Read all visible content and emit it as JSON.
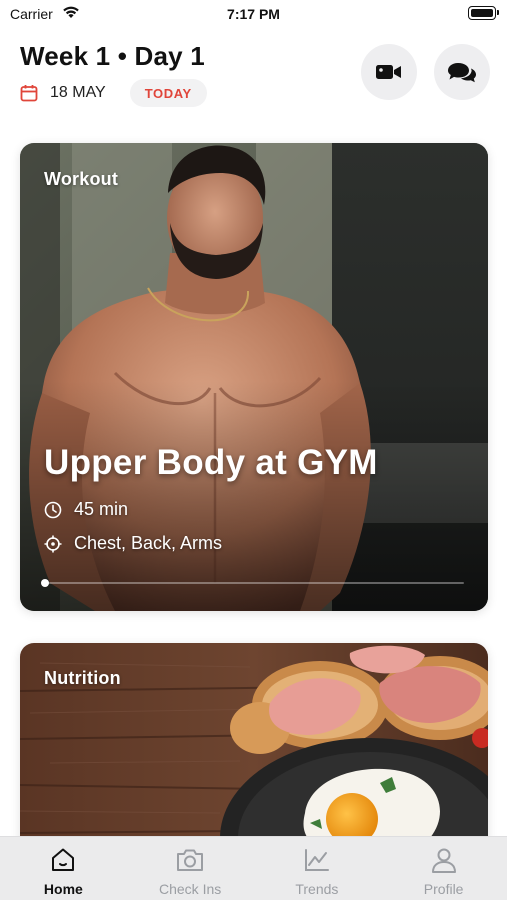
{
  "status_bar": {
    "carrier": "Carrier",
    "time": "7:17 PM"
  },
  "header": {
    "title": "Week 1 • Day 1",
    "date": "18 MAY",
    "today_badge": "TODAY"
  },
  "workout_card": {
    "label": "Workout",
    "title": "Upper Body at GYM",
    "duration": "45 min",
    "focus": "Chest, Back, Arms",
    "progress": 0
  },
  "nutrition_card": {
    "label": "Nutrition"
  },
  "tab_bar": {
    "items": [
      {
        "label": "Home",
        "icon": "home-icon",
        "active": true
      },
      {
        "label": "Check Ins",
        "icon": "camera-icon",
        "active": false
      },
      {
        "label": "Trends",
        "icon": "trends-icon",
        "active": false
      },
      {
        "label": "Profile",
        "icon": "profile-icon",
        "active": false
      }
    ]
  },
  "colors": {
    "accent": "#e0453a",
    "tab_active": "#111111",
    "tab_inactive": "#9b9ea3"
  }
}
